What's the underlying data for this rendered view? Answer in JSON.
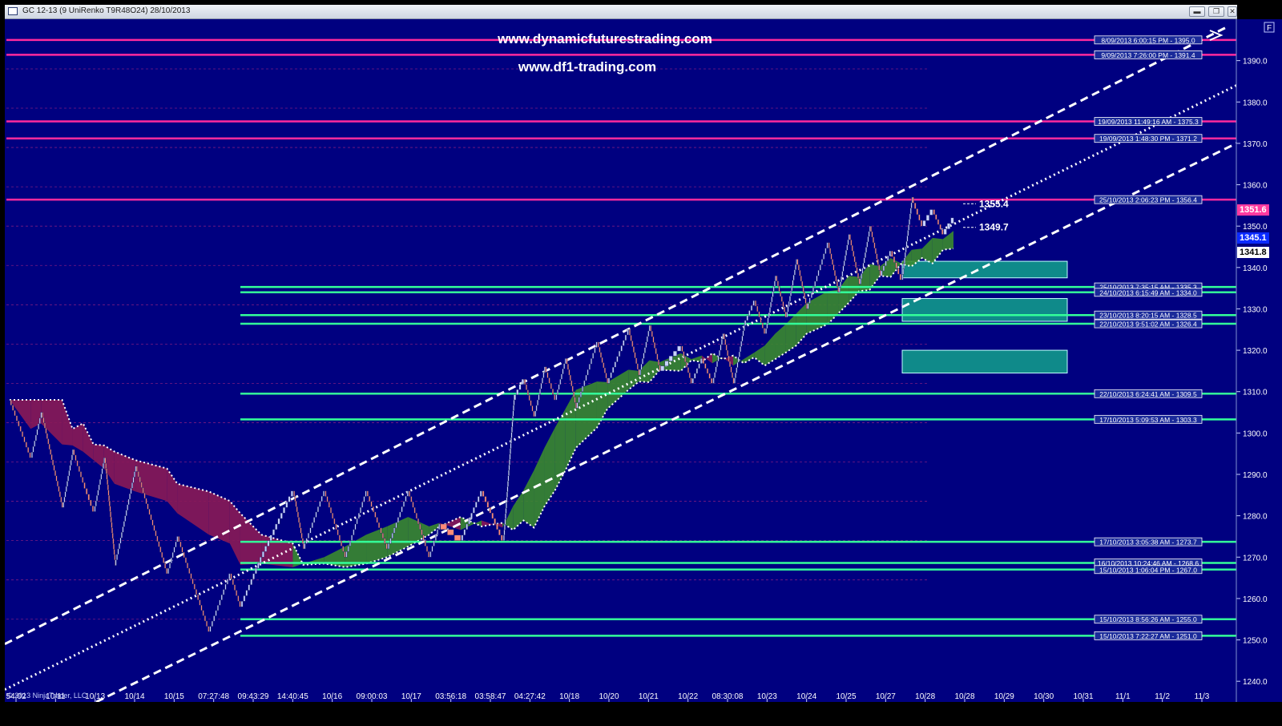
{
  "window": {
    "title": "GC 12-13 (9 UniRenko T9R48O24)  28/10/2013",
    "buttons": {
      "minimize": "▬",
      "restore": "❐",
      "close": "✕"
    },
    "panel_button": "F"
  },
  "watermarks": [
    "www.dynamicfuturestrading.com",
    "www.df1-trading.com"
  ],
  "copyright": "© 2013 NinjaTrader, LLC",
  "current_prices": {
    "last": "1351.6",
    "cyan": "1345.1",
    "white": "1341.8"
  },
  "level_labels": [
    {
      "text": "1355.4",
      "price": 1355.4
    },
    {
      "text": "1349.7",
      "price": 1349.7
    }
  ],
  "colors": {
    "background": "#000080",
    "resistance": "#ff2a9e",
    "support": "#33ff99",
    "down_bar": "#ff8a78",
    "up_bar": "#c8d2ff",
    "cloud_bear": "#8a1a55",
    "cloud_bull": "#3a8a2e",
    "supply_zone": "#0f8a8a"
  },
  "chart_data": {
    "type": "candlestick",
    "instrument": "GC 12-13",
    "ylim": [
      1235,
      1400
    ],
    "y_ticks": [
      "1240.0",
      "1250.0",
      "1260.0",
      "1270.0",
      "1280.0",
      "1290.0",
      "1300.0",
      "1310.0",
      "1320.0",
      "1330.0",
      "1340.0",
      "1350.0",
      "1360.0",
      "1370.0",
      "1380.0",
      "1390.0"
    ],
    "x_ticks": [
      "54:02",
      "10/11",
      "10/13",
      "10/14",
      "10/15",
      "07:27:48",
      "09:43:29",
      "14:40:45",
      "10/16",
      "09:00:03",
      "10/17",
      "03:56:18",
      "03:58:47",
      "04:27:42",
      "10/18",
      "10/20",
      "10/21",
      "10/22",
      "08:30:08",
      "10/23",
      "10/24",
      "10/25",
      "10/27",
      "10/28",
      "10/28",
      "10/29",
      "10/30",
      "10/31",
      "11/1",
      "11/2",
      "11/3"
    ],
    "resistance_levels": [
      {
        "label": "8/09/2013 6:00:15 PM - 1395.0",
        "price": 1395.0
      },
      {
        "label": "9/09/2013 7:26:00 PM - 1391.4",
        "price": 1391.4
      },
      {
        "label": "19/09/2013 11:49:16 AM - 1375.3",
        "price": 1375.3
      },
      {
        "label": "19/09/2013 1:48:30 PM - 1371.2",
        "price": 1371.2
      },
      {
        "label": "25/10/2013 2:06:23 PM - 1356.4",
        "price": 1356.4
      }
    ],
    "support_levels": [
      {
        "label": "25/10/2013 7:35:15 AM - 1335.3",
        "price": 1335.3
      },
      {
        "label": "24/10/2013 6:15:49 AM - 1334.0",
        "price": 1334.0
      },
      {
        "label": "23/10/2013 8:20:15 AM - 1328.5",
        "price": 1328.5
      },
      {
        "label": "22/10/2013 9:51:02 AM - 1326.4",
        "price": 1326.4
      },
      {
        "label": "22/10/2013 6:24:41 AM - 1309.5",
        "price": 1309.5
      },
      {
        "label": "17/10/2013 5:09:53 AM - 1303.3",
        "price": 1303.3
      },
      {
        "label": "17/10/2013 3:05:38 AM - 1273.7",
        "price": 1273.7
      },
      {
        "label": "16/10/2013 10:24:46 AM - 1268.6",
        "price": 1268.6
      },
      {
        "label": "15/10/2013 1:06:04 PM - 1267.0",
        "price": 1267.0
      },
      {
        "label": "15/10/2013 8:56:26 AM - 1255.0",
        "price": 1255.0
      },
      {
        "label": "15/10/2013 7:22:27 AM - 1251.0",
        "price": 1251.0
      }
    ],
    "supply_zones": [
      {
        "top": 1341.5,
        "bottom": 1337.5
      },
      {
        "top": 1332.5,
        "bottom": 1327.0
      },
      {
        "top": 1320.0,
        "bottom": 1314.5
      }
    ],
    "price_path": [
      [
        0,
        1308
      ],
      [
        2,
        1294
      ],
      [
        3,
        1305
      ],
      [
        5,
        1282
      ],
      [
        6,
        1296
      ],
      [
        7,
        1288
      ],
      [
        8,
        1281
      ],
      [
        9,
        1294
      ],
      [
        10,
        1268
      ],
      [
        12,
        1292
      ],
      [
        15,
        1266
      ],
      [
        16,
        1275
      ],
      [
        19,
        1252
      ],
      [
        21,
        1266
      ],
      [
        22,
        1258
      ],
      [
        24,
        1270
      ],
      [
        27,
        1286
      ],
      [
        28,
        1272
      ],
      [
        30,
        1286
      ],
      [
        32,
        1270
      ],
      [
        34,
        1286
      ],
      [
        36,
        1272
      ],
      [
        38,
        1286
      ],
      [
        40,
        1270
      ],
      [
        41,
        1278
      ],
      [
        43,
        1274
      ],
      [
        45,
        1286
      ],
      [
        47,
        1274
      ],
      [
        48,
        1308
      ],
      [
        49,
        1313
      ],
      [
        50,
        1304
      ],
      [
        51,
        1316
      ],
      [
        52,
        1308
      ],
      [
        53,
        1318
      ],
      [
        54,
        1306
      ],
      [
        56,
        1322
      ],
      [
        57,
        1312
      ],
      [
        59,
        1325
      ],
      [
        60,
        1314
      ],
      [
        61,
        1326
      ],
      [
        62,
        1315
      ],
      [
        64,
        1321
      ],
      [
        65,
        1312
      ],
      [
        66,
        1318
      ],
      [
        67,
        1312
      ],
      [
        68,
        1324
      ],
      [
        69,
        1312
      ],
      [
        70,
        1326
      ],
      [
        71,
        1332
      ],
      [
        72,
        1324
      ],
      [
        73,
        1338
      ],
      [
        74,
        1328
      ],
      [
        75,
        1342
      ],
      [
        76,
        1330
      ],
      [
        78,
        1346
      ],
      [
        79,
        1334
      ],
      [
        80,
        1348
      ],
      [
        81,
        1336
      ],
      [
        82,
        1350
      ],
      [
        83,
        1338
      ],
      [
        84,
        1344
      ],
      [
        85,
        1337
      ],
      [
        86,
        1357
      ],
      [
        87,
        1350
      ],
      [
        88,
        1354
      ],
      [
        89,
        1348
      ],
      [
        90,
        1352
      ]
    ],
    "channel": {
      "upper_start": [
        1250,
        1286
      ],
      "upper_end": [
        1400,
        1400
      ],
      "middle_start": [
        1240,
        1253
      ],
      "middle_end": [
        1400,
        1390
      ],
      "lower_start": [
        1235,
        1250
      ],
      "lower_end": [
        1400,
        1370
      ]
    }
  }
}
